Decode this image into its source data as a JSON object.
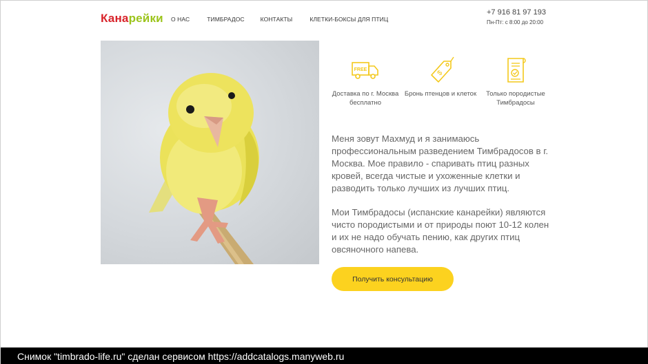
{
  "header": {
    "logo_part1": "Кана",
    "logo_part2": "рейки",
    "nav": [
      "О НАС",
      "ТИМБРАДОС",
      "КОНТАКТЫ",
      "КЛЕТКИ-БОКСЫ ДЛЯ ПТИЦ"
    ],
    "phone": "+7 916 81 97 193",
    "hours": "Пн-Пт: с 8:00 до 20:00"
  },
  "features": [
    {
      "icon": "free-delivery-truck-icon",
      "label": "Доставка по г. Москва бесплатно"
    },
    {
      "icon": "price-tag-icon",
      "label": "Бронь птенцов и клеток"
    },
    {
      "icon": "certificate-icon",
      "label": "Только породистые Тимбрадосы"
    }
  ],
  "truck_badge": "FREE",
  "about": {
    "p1": "Меня зовут Махмуд и я занимаюсь профессиональным разведением Тимбрадосов в г. Москва. Мое правило - спаривать птиц разных кровей, всегда чистые и ухоженные клетки и разводить только лучших из лучших птиц.",
    "p2": "Мои Тимбрадосы (испанские канарейки) являются чисто породистыми и от природы поют 10-12 колен и их не надо обучать пению, как других птиц овсяночного напева."
  },
  "cta_label": "Получить консультацию",
  "footer": "Снимок \"timbrado-life.ru\" сделан сервисом https://addcatalogs.manyweb.ru",
  "colors": {
    "accent": "#fcd21f",
    "icon": "#f3c81a",
    "logo_red": "#d8232a",
    "logo_green": "#9cc41c"
  }
}
